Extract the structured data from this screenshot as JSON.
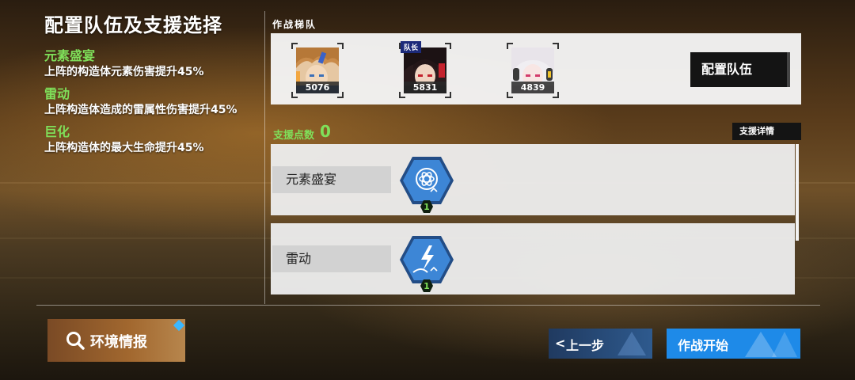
{
  "page": {
    "title": "配置队伍及支援选择"
  },
  "buffs": [
    {
      "name": "元素盛宴",
      "desc": "上阵的构造体元素伤害提升45%"
    },
    {
      "name": "雷动",
      "desc": "上阵构造体造成的雷属性伤害提升45%"
    },
    {
      "name": "巨化",
      "desc": "上阵构造体的最大生命提升45%"
    }
  ],
  "team": {
    "title": "作战梯队",
    "captain_tag": "队长",
    "members": [
      {
        "power": "5076"
      },
      {
        "power": "5831"
      },
      {
        "power": "4839"
      }
    ],
    "config_label": "配置队伍"
  },
  "support": {
    "label": "支援点数",
    "points": "0",
    "detail_label": "支援详情",
    "items": [
      {
        "name": "元素盛宴",
        "level": "1",
        "icon": "atom-icon"
      },
      {
        "name": "雷动",
        "level": "1",
        "icon": "lightning-icon"
      }
    ]
  },
  "footer": {
    "env_label": "环境情报",
    "back_label": "上一步",
    "back_chevron": "<",
    "start_label": "作战开始"
  },
  "colors": {
    "accent_green": "#7fe05a",
    "button_blue": "#1e8ae8",
    "hex_blue": "#3d86d6"
  }
}
